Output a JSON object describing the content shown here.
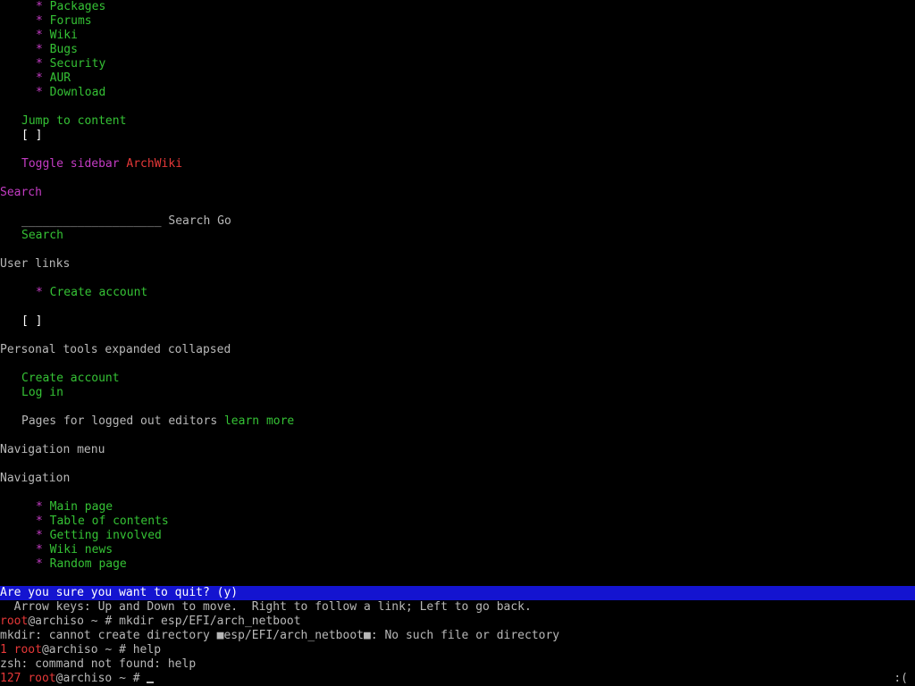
{
  "top_nav": {
    "bullet": "*",
    "items": [
      "Packages",
      "Forums",
      "Wiki",
      "Bugs",
      "Security",
      "AUR",
      "Download"
    ]
  },
  "jump_to_content": "Jump to content",
  "checkbox_1": "[ ]",
  "toggle_sidebar": "Toggle sidebar",
  "archwiki": "ArchWiki",
  "search_heading": "Search",
  "search_field": "____________________",
  "search_label": "Search",
  "go_label": "Go",
  "search_link": "Search",
  "user_links_heading": "User links",
  "create_account_bullet_link": "Create account",
  "checkbox_2": "[ ]",
  "personal_tools_heading": "Personal tools expanded collapsed",
  "create_account_link": "Create account",
  "log_in_link": "Log in",
  "pages_for_logged_out": "Pages for logged out editors",
  "learn_more": "learn more",
  "navigation_menu_heading": "Navigation menu",
  "navigation_heading": "Navigation",
  "nav_items": [
    "Main page",
    "Table of contents",
    "Getting involved",
    "Wiki news",
    "Random page"
  ],
  "status_prompt": "Are you sure you want to quit? (y)",
  "help_line": "  Arrow keys: Up and Down to move.  Right to follow a link; Left to go back.",
  "shell": {
    "user": "root",
    "host": "@archiso",
    "prompt_suffix": " ~ # ",
    "cmd1": "mkdir esp/EFI/arch_netboot",
    "err1": "mkdir: cannot create directory ■esp/EFI/arch_netboot■: No such file or directory",
    "code2": "1",
    "cmd2": "help",
    "err2": "zsh: command not found: help",
    "code3": "127"
  },
  "right_indicator": ":(",
  "colors": {
    "link": "#35c235",
    "magenta": "#c43cc4",
    "red": "#e63838",
    "text": "#b8b8b8",
    "status_bar": "#1414d0"
  }
}
